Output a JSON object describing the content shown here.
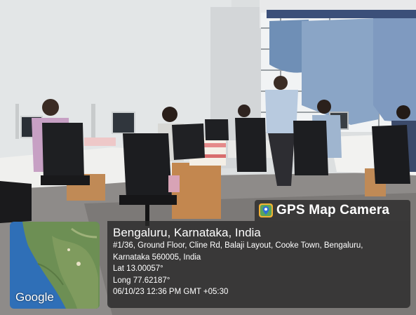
{
  "app": {
    "name": "GPS Map Camera"
  },
  "map": {
    "brand": "Google"
  },
  "location": {
    "title": "Bengaluru, Karnataka, India",
    "address_line1": "#1/36, Ground Floor, Cline Rd, Balaji Layout, Cooke Town, Bengaluru,",
    "address_line2": "Karnataka 560005, India",
    "lat": "Lat 13.00057°",
    "long": "Long 77.62187°",
    "datetime": "06/10/23 12:36 PM GMT +05:30"
  },
  "scene": {
    "description_label": "office-room-with-workstations"
  }
}
